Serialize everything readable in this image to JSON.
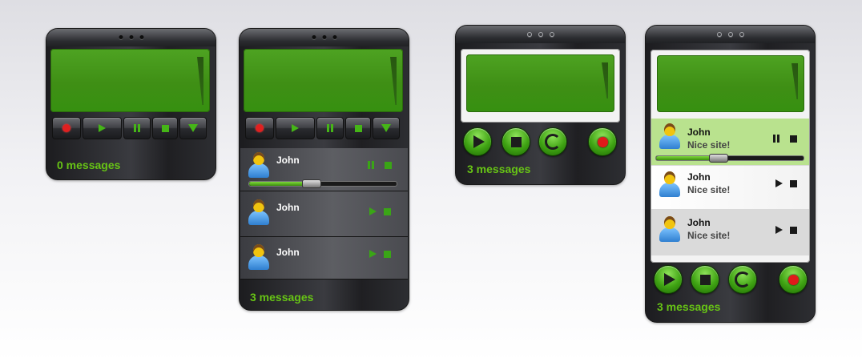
{
  "colors": {
    "accent_green": "#67c415",
    "record_red": "#e02020",
    "highlight_row": "#b9e28e"
  },
  "widget1": {
    "status": "0 messages"
  },
  "widget2": {
    "status": "3 messages",
    "progress": 0.42,
    "messages": [
      {
        "name": "John",
        "state": "playing"
      },
      {
        "name": "John",
        "state": "stopped"
      },
      {
        "name": "John",
        "state": "stopped"
      }
    ]
  },
  "widget3": {
    "status": "3 messages"
  },
  "widget4": {
    "status": "3 messages",
    "progress": 0.42,
    "messages": [
      {
        "name": "John",
        "text": "Nice site!",
        "state": "playing"
      },
      {
        "name": "John",
        "text": "Nice site!",
        "state": "stopped"
      },
      {
        "name": "John",
        "text": "Nice site!",
        "state": "stopped"
      }
    ]
  },
  "icons": {
    "transport": [
      "record-icon",
      "play-icon",
      "pause-icon",
      "stop-icon",
      "dropdown-icon"
    ],
    "round_buttons": [
      "play-icon",
      "stop-icon",
      "refresh-icon",
      "record-icon"
    ],
    "avatar": "user-avatar-icon"
  }
}
